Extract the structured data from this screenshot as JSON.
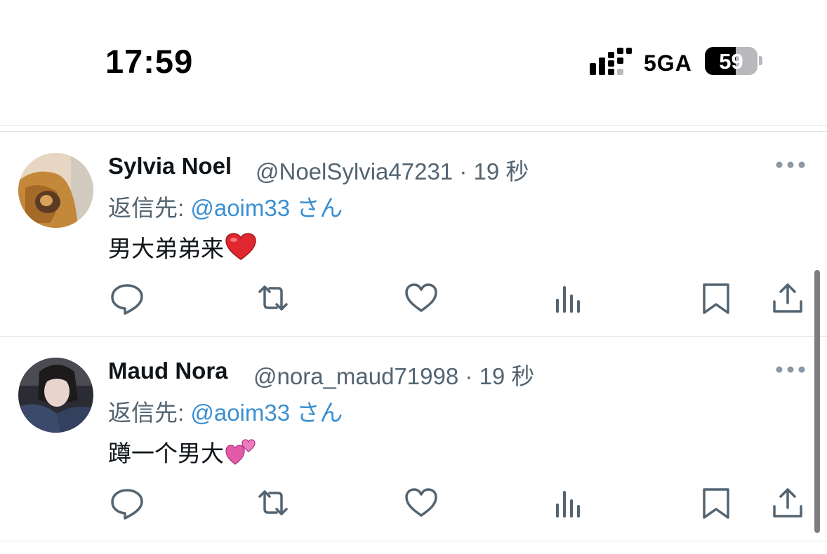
{
  "status_bar": {
    "time": "17:59",
    "network": "5GA",
    "battery": "59",
    "battery_level": 0.59
  },
  "tweets": [
    {
      "name": "Sylvia Noel",
      "handle": "@NoelSylvia47231",
      "separator": "·",
      "time": "19 秒",
      "reply_prefix": "返信先:",
      "reply_mention": "@aoim33",
      "reply_suffix": "さん",
      "text": "男大弟弟来",
      "emoji": "red-heart",
      "avatar": "orange-jacket-photo"
    },
    {
      "name": "Maud Nora",
      "handle": "@nora_maud71998",
      "separator": "·",
      "time": "19 秒",
      "reply_prefix": "返信先:",
      "reply_mention": "@aoim33",
      "reply_suffix": "さん",
      "text": "蹲一个男大",
      "emoji": "two-hearts",
      "avatar": "girl-portrait-photo"
    }
  ],
  "icons": [
    "more-icon",
    "reply-icon",
    "retweet-icon",
    "like-icon",
    "views-icon",
    "bookmark-icon",
    "share-icon"
  ],
  "colors": {
    "mention": "#3a8fd1",
    "secondary_text": "#536471",
    "icon": "#536471"
  }
}
